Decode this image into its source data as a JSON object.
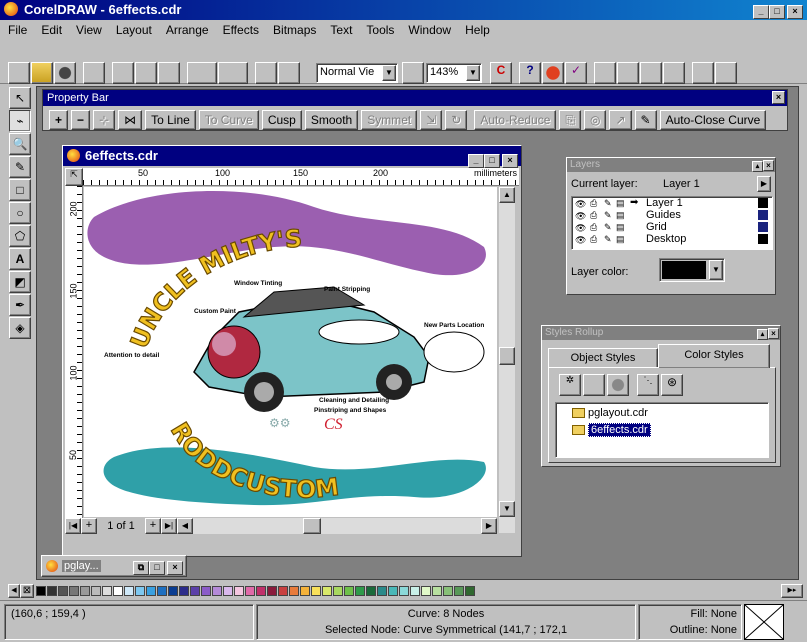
{
  "app": {
    "title": "CorelDRAW - 6effects.cdr"
  },
  "menu": [
    "File",
    "Edit",
    "View",
    "Layout",
    "Arrange",
    "Effects",
    "Bitmaps",
    "Text",
    "Tools",
    "Window",
    "Help"
  ],
  "toolbar": {
    "view_mode": "Normal Vie",
    "zoom": "143%"
  },
  "property_bar": {
    "title": "Property Bar",
    "to_line": "To Line",
    "to_curve": "To Curve",
    "cusp": "Cusp",
    "smooth": "Smooth",
    "symmet": "Symmet",
    "auto_reduce": "Auto-Reduce",
    "auto_close": "Auto-Close Curve"
  },
  "document": {
    "title": "6effects.cdr",
    "ruler_units": "millimeters",
    "ruler_h": [
      "50",
      "100",
      "150",
      "200"
    ],
    "ruler_v": [
      "200",
      "150",
      "100",
      "50"
    ],
    "page_counter": "1 of 1"
  },
  "artwork": {
    "top_arc": "UNCLE MILTY'S",
    "bottom_arc": "RODDCUSTOM",
    "labels": [
      "Window Tinting",
      "Paint Stripping",
      "Custom Paint",
      "New Parts Location",
      "Attention to detail",
      "Cleaning and Detailing",
      "Pinstriping and Shapes"
    ]
  },
  "layers": {
    "title": "Layers",
    "current_label": "Current layer:",
    "current_value": "Layer 1",
    "items": [
      {
        "name": "Layer 1",
        "color": "#000000"
      },
      {
        "name": "Guides",
        "color": "#1a237e"
      },
      {
        "name": "Grid",
        "color": "#1a237e"
      },
      {
        "name": "Desktop",
        "color": "#000000"
      }
    ],
    "color_label": "Layer color:"
  },
  "styles": {
    "title": "Styles Rollup",
    "tab_object": "Object Styles",
    "tab_color": "Color Styles",
    "files": [
      "pglayout.cdr",
      "6effects.cdr"
    ]
  },
  "minimized": {
    "title": "pglay..."
  },
  "status": {
    "coords": "(160,6 ; 159,4 )",
    "curve": "Curve: 8 Nodes",
    "node": "Selected Node: Curve Symmetrical (141,7 ; 172,1",
    "fill": "Fill: None",
    "outline": "Outline: None"
  },
  "palette": [
    "#000000",
    "#333333",
    "#555555",
    "#777777",
    "#999999",
    "#bbbbbb",
    "#dddddd",
    "#ffffff",
    "#cfe8f8",
    "#7ec8f0",
    "#3aa0e0",
    "#1e6fc0",
    "#0a3d91",
    "#2b2b8a",
    "#5a3fa8",
    "#8b5cc8",
    "#b48ad8",
    "#d9b8ec",
    "#f4c6e0",
    "#e06aa8",
    "#c0306a",
    "#8a1b3c",
    "#c84040",
    "#e87a3a",
    "#f4b23a",
    "#f8e05a",
    "#d8e86a",
    "#a8d860",
    "#6ec04a",
    "#2e9a4a",
    "#1a6a3a",
    "#2a8a8a",
    "#4ab8b8",
    "#8ad8d8",
    "#c8f0e8",
    "#e0f8c8",
    "#b8e0a0",
    "#88c078",
    "#589858",
    "#306830"
  ]
}
